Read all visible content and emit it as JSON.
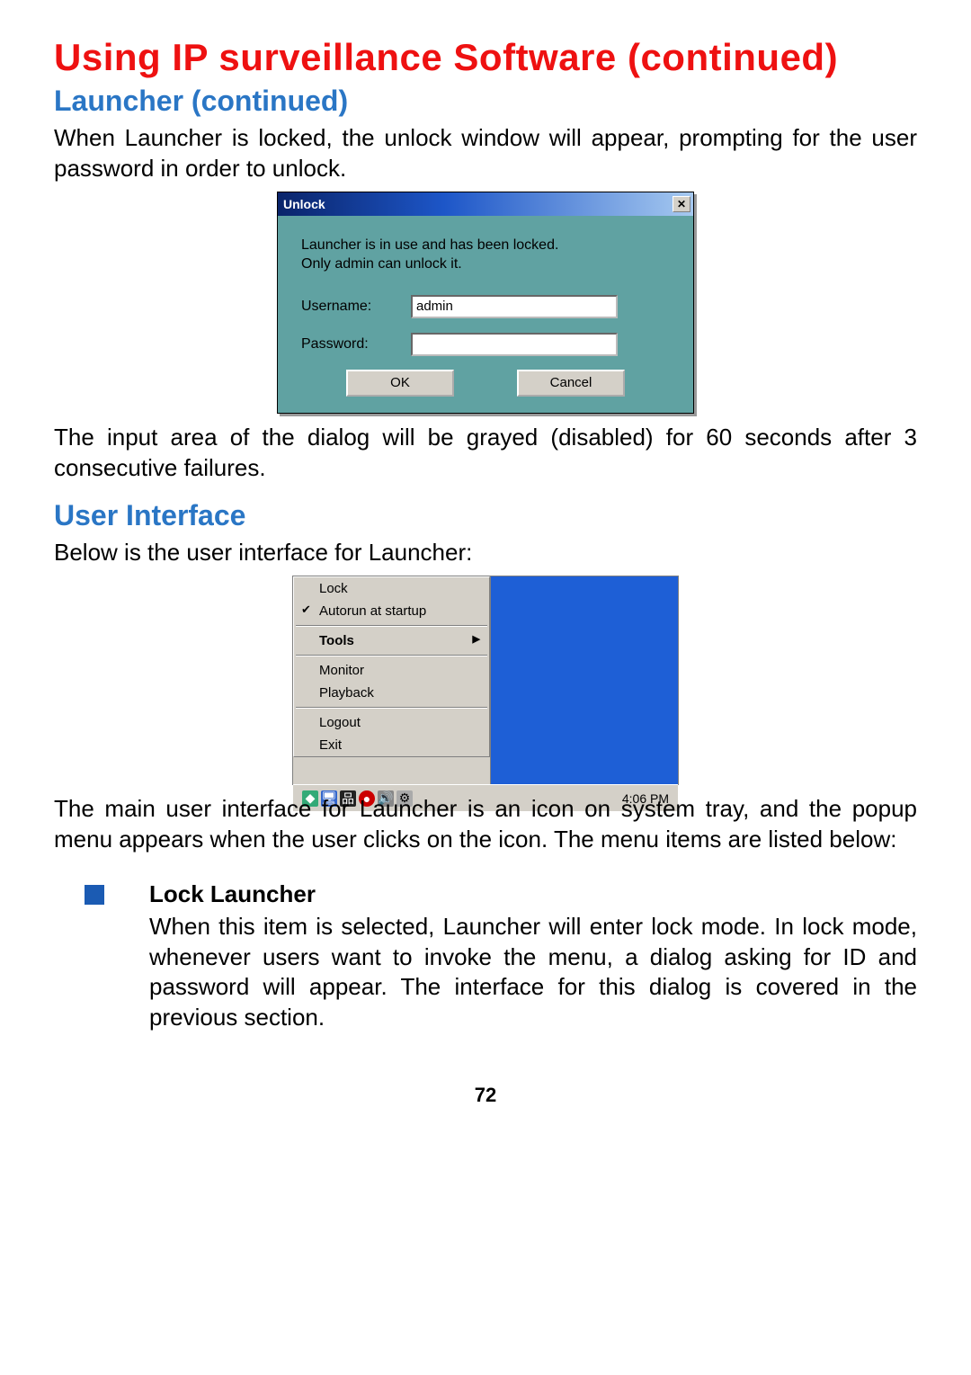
{
  "headings": {
    "main": "Using IP surveillance Software (continued)",
    "sub1": "Launcher (continued)",
    "sub2": "User Interface"
  },
  "paragraphs": {
    "p1": "When Launcher is locked, the unlock window will appear, prompting for the user password in order to unlock.",
    "p2": "The input area of the dialog will be grayed (disabled) for 60 seconds after 3 consecutive failures.",
    "p3": "Below is the user interface for Launcher:",
    "p4": "The main user interface for Launcher is an icon on system tray, and the popup menu appears when the user clicks on the icon. The menu items are listed below:"
  },
  "unlock_dialog": {
    "title": "Unlock",
    "message_line1": "Launcher is in use and has been locked.",
    "message_line2": "Only admin can unlock it.",
    "username_label": "Username:",
    "username_value": "admin",
    "password_label": "Password:",
    "password_value": "",
    "ok": "OK",
    "cancel": "Cancel"
  },
  "context_menu": {
    "items": {
      "lock": "Lock",
      "autorun": "Autorun at startup",
      "tools": "Tools",
      "monitor": "Monitor",
      "playback": "Playback",
      "logout": "Logout",
      "exit": "Exit"
    },
    "clock": "4:06 PM"
  },
  "bullet": {
    "title": "Lock Launcher",
    "text": "When this item is selected, Launcher will enter lock mode. In lock mode, whenever users want to invoke the menu, a dialog asking for ID and password will appear. The interface for this dialog is covered in the previous section."
  },
  "page_number": "72"
}
